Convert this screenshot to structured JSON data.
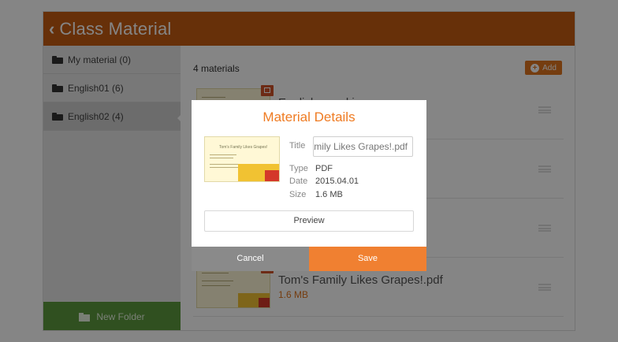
{
  "header": {
    "back_glyph": "‹",
    "title": "Class Material"
  },
  "sidebar": {
    "folders": [
      {
        "label": "My material (0)"
      },
      {
        "label": "English01 (6)"
      },
      {
        "label": "English02 (4)"
      }
    ],
    "new_folder_label": "New Folder"
  },
  "main": {
    "count_label": "4 materials",
    "add_label": "Add",
    "rows": [
      {
        "name": "English speaking",
        "size": ""
      },
      {
        "name": "",
        "size": ""
      },
      {
        "name": "",
        "size": ""
      },
      {
        "name": "Tom's Family Likes Grapes!.pdf",
        "size": "1.6 MB"
      }
    ]
  },
  "dialog": {
    "title": "Material Details",
    "thumbnail_title": "Tom's Family Likes Grapes!",
    "title_label": "Title",
    "title_value": "Tom's Family Likes Grapes!.pdf",
    "type_label": "Type",
    "type_value": "PDF",
    "date_label": "Date",
    "date_value": "2015.04.01",
    "size_label": "Size",
    "size_value": "1.6 MB",
    "preview_label": "Preview",
    "cancel_label": "Cancel",
    "save_label": "Save"
  },
  "colors": {
    "header": "#c65d13",
    "accent": "#ef7b22",
    "new_folder": "#5c9a3f",
    "cancel": "#8a8a8a"
  }
}
